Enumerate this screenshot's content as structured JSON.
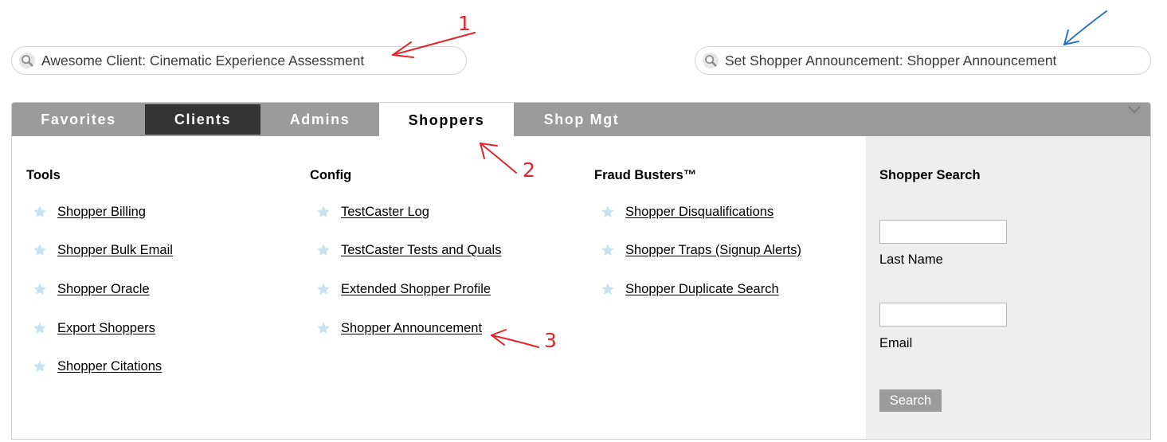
{
  "search_bars": {
    "left": {
      "text": "Awesome Client: Cinematic Experience Assessment",
      "icon": "magnifier-icon"
    },
    "right": {
      "text": "Set Shopper Announcement: Shopper Announcement",
      "icon": "magnifier-icon"
    }
  },
  "tabs": [
    {
      "label": "Favorites",
      "state": "normal"
    },
    {
      "label": "Clients",
      "state": "dark"
    },
    {
      "label": "Admins",
      "state": "normal"
    },
    {
      "label": "Shoppers",
      "state": "active"
    },
    {
      "label": "Shop Mgt",
      "state": "normal"
    }
  ],
  "columns": [
    {
      "heading": "Tools",
      "items": [
        "Shopper Billing",
        "Shopper Bulk Email",
        "Shopper Oracle",
        "Export Shoppers",
        "Shopper Citations"
      ]
    },
    {
      "heading": "Config",
      "items": [
        "TestCaster Log",
        "TestCaster Tests and Quals",
        "Extended Shopper Profile",
        "Shopper Announcement"
      ]
    },
    {
      "heading": "Fraud Busters™",
      "items": [
        "Shopper Disqualifications",
        "Shopper Traps (Signup Alerts)",
        "Shopper Duplicate Search"
      ]
    }
  ],
  "shopper_search": {
    "heading": "Shopper Search",
    "last_name_label": "Last Name",
    "last_name_value": "",
    "email_label": "Email",
    "email_value": "",
    "button_label": "Search"
  },
  "annotations": {
    "labels": [
      "1",
      "2",
      "3"
    ],
    "red_color": "#e0262b",
    "blue_color": "#2e6fd0"
  },
  "colors": {
    "tabbar": "#9b9b9b",
    "dark_tab": "#333333",
    "side_panel": "#eeeeee",
    "star": "#c6e3f2"
  }
}
